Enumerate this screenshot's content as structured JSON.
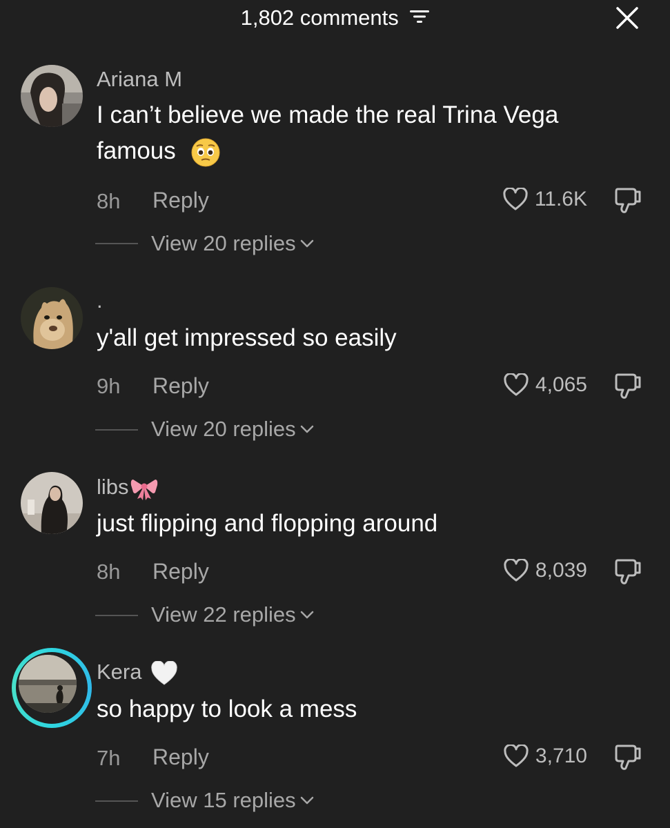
{
  "header": {
    "comment_count": "1,802 comments",
    "sort_icon": "sort-icon",
    "close_icon": "close-icon"
  },
  "comments": [
    {
      "username": "Ariana M",
      "text": "I can’t believe we made the real Trina Vega famous",
      "emoji": "pleading-face",
      "time": "8h",
      "reply_label": "Reply",
      "likes": "11.6K",
      "view_replies": "View 20 replies"
    },
    {
      "username": ".",
      "text": "y'all get impressed so easily",
      "time": "9h",
      "reply_label": "Reply",
      "likes": "4,065",
      "view_replies": "View 20 replies"
    },
    {
      "username": "libs",
      "username_emoji": "ribbon",
      "text": "just flipping and flopping around",
      "time": "8h",
      "reply_label": "Reply",
      "likes": "8,039",
      "view_replies": "View 22 replies"
    },
    {
      "username": "Kera",
      "username_emoji": "white-heart",
      "text": "so happy to look a mess",
      "time": "7h",
      "reply_label": "Reply",
      "likes": "3,710",
      "view_replies": "View 15 replies"
    }
  ],
  "colors": {
    "background": "#202020",
    "story_ring": "#2fd6e0"
  }
}
